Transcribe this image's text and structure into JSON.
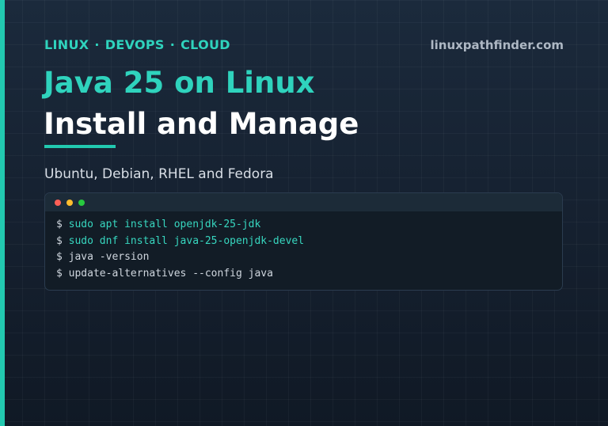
{
  "header": {
    "tags": [
      "LINUX",
      "DEVOPS",
      "CLOUD"
    ],
    "separator": "·",
    "site": "linuxpathfinder.com"
  },
  "title": {
    "line1": "Java 25 on Linux",
    "line2": "Install and Manage"
  },
  "subtitle": "Ubuntu, Debian, RHEL and Fedora",
  "terminal": {
    "prompt": "$",
    "commands": [
      "sudo apt install openjdk-25-jdk",
      "sudo dnf install java-25-openjdk-devel",
      "java -version",
      "update-alternatives --config java"
    ]
  },
  "colors": {
    "accent": "#22c9b0",
    "accent_text": "#2fd3bd",
    "background": "#15202f",
    "terminal_bg": "#121c26",
    "dot_red": "#ff5f56",
    "dot_yellow": "#ffbd2e",
    "dot_green": "#27c93f"
  }
}
